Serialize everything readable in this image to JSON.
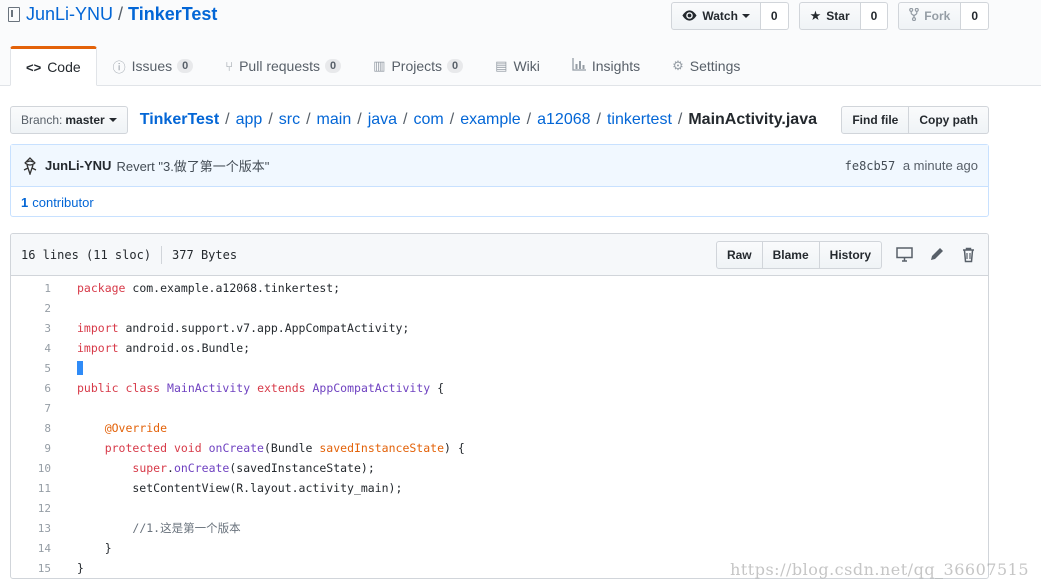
{
  "repo": {
    "owner": "JunLi-YNU",
    "separator": "/",
    "name": "TinkerTest"
  },
  "actions": {
    "watch": {
      "label": "Watch",
      "count": "0",
      "icon": "eye-icon"
    },
    "star": {
      "label": "Star",
      "count": "0",
      "icon": "star-icon"
    },
    "fork": {
      "label": "Fork",
      "count": "0",
      "icon": "fork-icon"
    }
  },
  "tabs": [
    {
      "label": "Code",
      "icon": "code-icon",
      "selected": true
    },
    {
      "label": "Issues",
      "count": "0",
      "icon": "issue-icon"
    },
    {
      "label": "Pull requests",
      "count": "0",
      "icon": "pull-request-icon"
    },
    {
      "label": "Projects",
      "count": "0",
      "icon": "project-icon"
    },
    {
      "label": "Wiki",
      "icon": "book-icon"
    },
    {
      "label": "Insights",
      "icon": "graph-icon"
    },
    {
      "label": "Settings",
      "icon": "gear-icon"
    }
  ],
  "branch": {
    "label": "Branch:",
    "value": "master"
  },
  "breadcrumb": {
    "root": "TinkerTest",
    "dirs": [
      "app",
      "src",
      "main",
      "java",
      "com",
      "example",
      "a12068",
      "tinkertest"
    ],
    "file": "MainActivity.java",
    "separator": "/"
  },
  "path_buttons": {
    "find_file": "Find file",
    "copy_path": "Copy path"
  },
  "commit": {
    "author": "JunLi-YNU",
    "message": "Revert \"3.做了第一个版本\"",
    "sha": "fe8cb57",
    "time": "a minute ago",
    "contributors_count": "1",
    "contributors_label": "contributor"
  },
  "file": {
    "lines_info": "16 lines (11 sloc)",
    "size": "377 Bytes",
    "buttons": {
      "raw": "Raw",
      "blame": "Blame",
      "history": "History"
    },
    "icons": [
      "desktop-icon",
      "pencil-icon",
      "trash-icon"
    ]
  },
  "code": {
    "line_numbers": [
      "1",
      "2",
      "3",
      "4",
      "5",
      "6",
      "7",
      "8",
      "9",
      "10",
      "11",
      "12",
      "13",
      "14",
      "15"
    ],
    "lines": [
      [
        [
          "kw",
          "package"
        ],
        [
          "t",
          " com.example.a12068.tinkertest;"
        ]
      ],
      [],
      [
        [
          "kw",
          "import"
        ],
        [
          "t",
          " android.support.v7.app.AppCompatActivity;"
        ]
      ],
      [
        [
          "kw",
          "import"
        ],
        [
          "t",
          " android.os.Bundle;"
        ]
      ],
      [
        [
          "cursor",
          ""
        ]
      ],
      [
        [
          "kw",
          "public"
        ],
        [
          "t",
          " "
        ],
        [
          "kw",
          "class"
        ],
        [
          "t",
          " "
        ],
        [
          "ent",
          "MainActivity"
        ],
        [
          "t",
          " "
        ],
        [
          "kw",
          "extends"
        ],
        [
          "t",
          " "
        ],
        [
          "ent",
          "AppCompatActivity"
        ],
        [
          "t",
          " {"
        ]
      ],
      [],
      [
        [
          "t",
          "    "
        ],
        [
          "ann",
          "@Override"
        ]
      ],
      [
        [
          "t",
          "    "
        ],
        [
          "kw",
          "protected"
        ],
        [
          "t",
          " "
        ],
        [
          "kw",
          "void"
        ],
        [
          "t",
          " "
        ],
        [
          "ent",
          "onCreate"
        ],
        [
          "t",
          "(Bundle "
        ],
        [
          "var",
          "savedInstanceState"
        ],
        [
          "t",
          ") {"
        ]
      ],
      [
        [
          "t",
          "        "
        ],
        [
          "kw",
          "super"
        ],
        [
          "t",
          "."
        ],
        [
          "ent",
          "onCreate"
        ],
        [
          "t",
          "(savedInstanceState);"
        ]
      ],
      [
        [
          "t",
          "        setContentView(R.layout.activity_main);"
        ]
      ],
      [],
      [
        [
          "t",
          "        "
        ],
        [
          "cm",
          "//1.这是第一个版本"
        ]
      ],
      [
        [
          "t",
          "    }"
        ]
      ],
      [
        [
          "t",
          "}"
        ]
      ]
    ]
  },
  "watermark": "https://blog.csdn.net/qq_36607515"
}
